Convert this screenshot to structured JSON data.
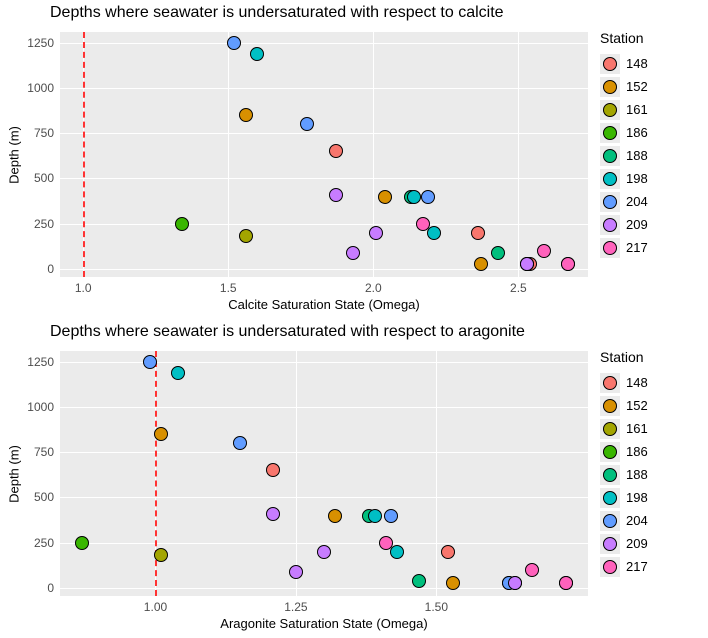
{
  "stations": [
    {
      "id": "148",
      "color": "#F8766D"
    },
    {
      "id": "152",
      "color": "#D89000"
    },
    {
      "id": "161",
      "color": "#A3A500"
    },
    {
      "id": "186",
      "color": "#39B600"
    },
    {
      "id": "188",
      "color": "#00BF7D"
    },
    {
      "id": "198",
      "color": "#00BFC4"
    },
    {
      "id": "204",
      "color": "#619CFF"
    },
    {
      "id": "209",
      "color": "#C77CFF"
    },
    {
      "id": "217",
      "color": "#FF62BC"
    }
  ],
  "legend": {
    "title": "Station"
  },
  "chart_data": [
    {
      "title": "Depths where seawater is undersaturated with respect to calcite",
      "type": "scatter",
      "xlabel": "Calcite Saturation State (Omega)",
      "ylabel": "Depth (m)",
      "xlim": [
        0.92,
        2.74
      ],
      "ylim": [
        1310,
        -45
      ],
      "xticks": [
        1.0,
        1.5,
        2.0,
        2.5
      ],
      "yticks": [
        0,
        250,
        500,
        750,
        1000,
        1250
      ],
      "ref_line_x": 1.0,
      "series": [
        {
          "station": "148",
          "points": [
            {
              "x": 2.54,
              "y": 25
            },
            {
              "x": 2.36,
              "y": 200
            },
            {
              "x": 1.87,
              "y": 650
            }
          ]
        },
        {
          "station": "152",
          "points": [
            {
              "x": 2.37,
              "y": 25
            },
            {
              "x": 2.04,
              "y": 400
            },
            {
              "x": 1.56,
              "y": 850
            }
          ]
        },
        {
          "station": "161",
          "points": [
            {
              "x": 2.53,
              "y": 25
            },
            {
              "x": 1.56,
              "y": 180
            }
          ]
        },
        {
          "station": "186",
          "points": [
            {
              "x": 1.34,
              "y": 250
            }
          ]
        },
        {
          "station": "188",
          "points": [
            {
              "x": 2.43,
              "y": 90
            },
            {
              "x": 2.13,
              "y": 400
            }
          ]
        },
        {
          "station": "198",
          "points": [
            {
              "x": 2.67,
              "y": 25
            },
            {
              "x": 2.21,
              "y": 200
            },
            {
              "x": 2.14,
              "y": 400
            },
            {
              "x": 1.6,
              "y": 1190
            }
          ]
        },
        {
          "station": "204",
          "points": [
            {
              "x": 2.53,
              "y": 25
            },
            {
              "x": 2.19,
              "y": 400
            },
            {
              "x": 1.77,
              "y": 800
            },
            {
              "x": 1.52,
              "y": 1250
            }
          ]
        },
        {
          "station": "209",
          "points": [
            {
              "x": 2.53,
              "y": 25
            },
            {
              "x": 1.93,
              "y": 90
            },
            {
              "x": 2.01,
              "y": 200
            },
            {
              "x": 1.87,
              "y": 410
            }
          ]
        },
        {
          "station": "217",
          "points": [
            {
              "x": 2.67,
              "y": 25
            },
            {
              "x": 2.59,
              "y": 100
            },
            {
              "x": 2.17,
              "y": 250
            }
          ]
        }
      ]
    },
    {
      "title": "Depths where seawater is undersaturated with respect to aragonite",
      "type": "scatter",
      "xlabel": "Aragonite Saturation State (Omega)",
      "ylabel": "Depth (m)",
      "xlim": [
        0.83,
        1.77
      ],
      "ylim": [
        1310,
        -45
      ],
      "xticks": [
        1.0,
        1.25,
        1.5
      ],
      "yticks": [
        0,
        250,
        500,
        750,
        1000,
        1250
      ],
      "ref_line_x": 1.0,
      "series": [
        {
          "station": "148",
          "points": [
            {
              "x": 1.64,
              "y": 25
            },
            {
              "x": 1.52,
              "y": 200
            },
            {
              "x": 1.21,
              "y": 650
            }
          ]
        },
        {
          "station": "152",
          "points": [
            {
              "x": 1.53,
              "y": 25
            },
            {
              "x": 1.32,
              "y": 400
            },
            {
              "x": 1.01,
              "y": 850
            }
          ]
        },
        {
          "station": "161",
          "points": [
            {
              "x": 1.63,
              "y": 25
            },
            {
              "x": 1.01,
              "y": 180
            }
          ]
        },
        {
          "station": "186",
          "points": [
            {
              "x": 0.87,
              "y": 250
            }
          ]
        },
        {
          "station": "188",
          "points": [
            {
              "x": 1.47,
              "y": 40
            },
            {
              "x": 1.38,
              "y": 400
            }
          ]
        },
        {
          "station": "198",
          "points": [
            {
              "x": 1.73,
              "y": 25
            },
            {
              "x": 1.43,
              "y": 200
            },
            {
              "x": 1.39,
              "y": 400
            },
            {
              "x": 1.04,
              "y": 1190
            }
          ]
        },
        {
          "station": "204",
          "points": [
            {
              "x": 1.63,
              "y": 25
            },
            {
              "x": 1.42,
              "y": 400
            },
            {
              "x": 1.15,
              "y": 800
            },
            {
              "x": 0.99,
              "y": 1250
            }
          ]
        },
        {
          "station": "209",
          "points": [
            {
              "x": 1.64,
              "y": 25
            },
            {
              "x": 1.25,
              "y": 90
            },
            {
              "x": 1.3,
              "y": 200
            },
            {
              "x": 1.21,
              "y": 410
            }
          ]
        },
        {
          "station": "217",
          "points": [
            {
              "x": 1.73,
              "y": 25
            },
            {
              "x": 1.67,
              "y": 100
            },
            {
              "x": 1.41,
              "y": 250
            }
          ]
        }
      ]
    }
  ]
}
